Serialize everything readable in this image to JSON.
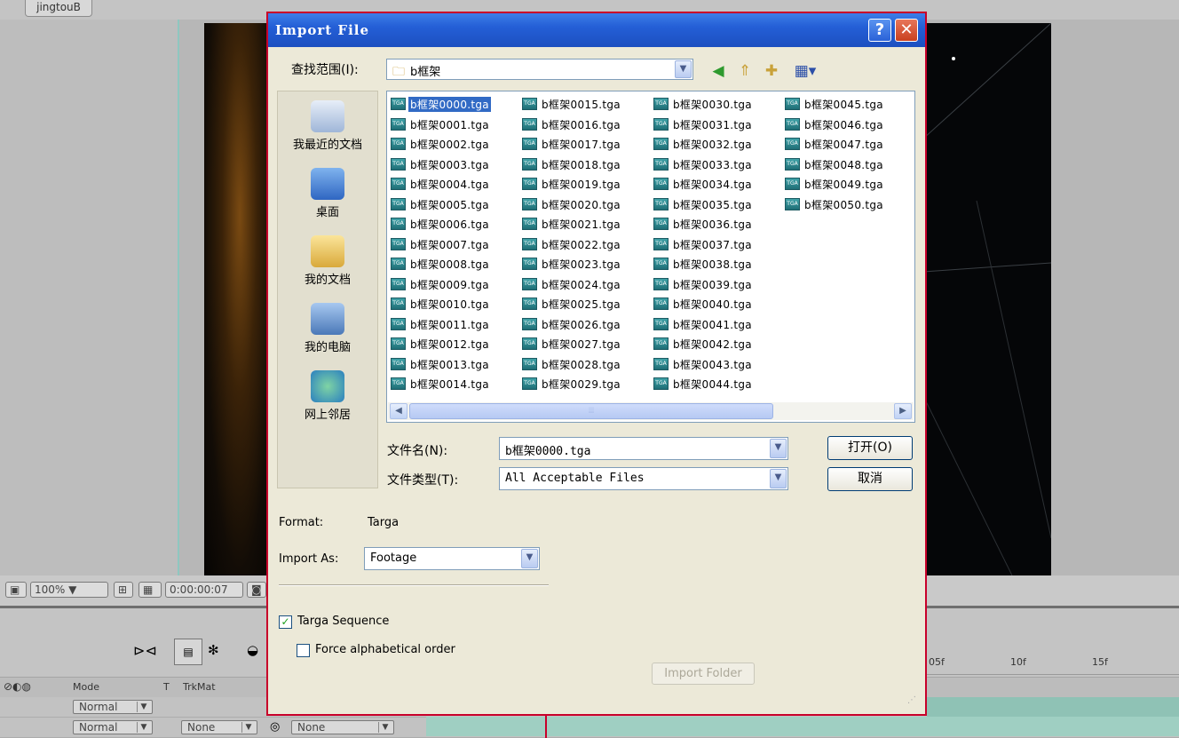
{
  "background": {
    "tab_label": "jingtouB",
    "viewer_bar": {
      "zoom": "100%",
      "timecode": "0:00:00:07"
    },
    "timeline": {
      "headers": {
        "mode": "Mode",
        "t": "T",
        "trkmat": "TrkMat"
      },
      "rows": [
        {
          "mode": "Normal"
        },
        {
          "mode": "Normal",
          "trkmat": "None",
          "parent": "None"
        }
      ],
      "ruler_ticks": [
        "05f",
        "10f",
        "15f"
      ]
    }
  },
  "dialog": {
    "title": "Import File",
    "help_label": "?",
    "close_label": "✕",
    "look_in_label": "查找范围(I):",
    "look_in_value": "b框架",
    "places": [
      {
        "label": "我最近的文档",
        "icon": "recent-documents-icon"
      },
      {
        "label": "桌面",
        "icon": "desktop-icon"
      },
      {
        "label": "我的文档",
        "icon": "my-documents-icon"
      },
      {
        "label": "我的电脑",
        "icon": "my-computer-icon"
      },
      {
        "label": "网上邻居",
        "icon": "network-places-icon"
      }
    ],
    "files": {
      "col1": [
        "b框架0000.tga",
        "b框架0001.tga",
        "b框架0002.tga",
        "b框架0003.tga",
        "b框架0004.tga",
        "b框架0005.tga",
        "b框架0006.tga",
        "b框架0007.tga",
        "b框架0008.tga",
        "b框架0009.tga",
        "b框架0010.tga",
        "b框架0011.tga",
        "b框架0012.tga",
        "b框架0013.tga",
        "b框架0014.tga"
      ],
      "col2": [
        "b框架0015.tga",
        "b框架0016.tga",
        "b框架0017.tga",
        "b框架0018.tga",
        "b框架0019.tga",
        "b框架0020.tga",
        "b框架0021.tga",
        "b框架0022.tga",
        "b框架0023.tga",
        "b框架0024.tga",
        "b框架0025.tga",
        "b框架0026.tga",
        "b框架0027.tga",
        "b框架0028.tga",
        "b框架0029.tga"
      ],
      "col3": [
        "b框架0030.tga",
        "b框架0031.tga",
        "b框架0032.tga",
        "b框架0033.tga",
        "b框架0034.tga",
        "b框架0035.tga",
        "b框架0036.tga",
        "b框架0037.tga",
        "b框架0038.tga",
        "b框架0039.tga",
        "b框架0040.tga",
        "b框架0041.tga",
        "b框架0042.tga",
        "b框架0043.tga",
        "b框架0044.tga"
      ],
      "col4": [
        "b框架0045.tga",
        "b框架0046.tga",
        "b框架0047.tga",
        "b框架0048.tga",
        "b框架0049.tga",
        "b框架0050.tga"
      ],
      "selected": "b框架0000.tga",
      "icon_text": "TGA"
    },
    "filename_label": "文件名(N):",
    "filename_value": "b框架0000.tga",
    "filetype_label": "文件类型(T):",
    "filetype_value": "All Acceptable Files",
    "open_button": "打开(O)",
    "cancel_button": "取消",
    "format_label": "Format:",
    "format_value": "Targa",
    "import_as_label": "Import As:",
    "import_as_value": "Footage",
    "targa_sequence_label": "Targa Sequence",
    "targa_sequence_checked": true,
    "force_alpha_label": "Force alphabetical order",
    "force_alpha_checked": false,
    "import_folder_button": "Import Folder",
    "accent_color": "#245fd6",
    "highlight_color": "#316ac5"
  }
}
